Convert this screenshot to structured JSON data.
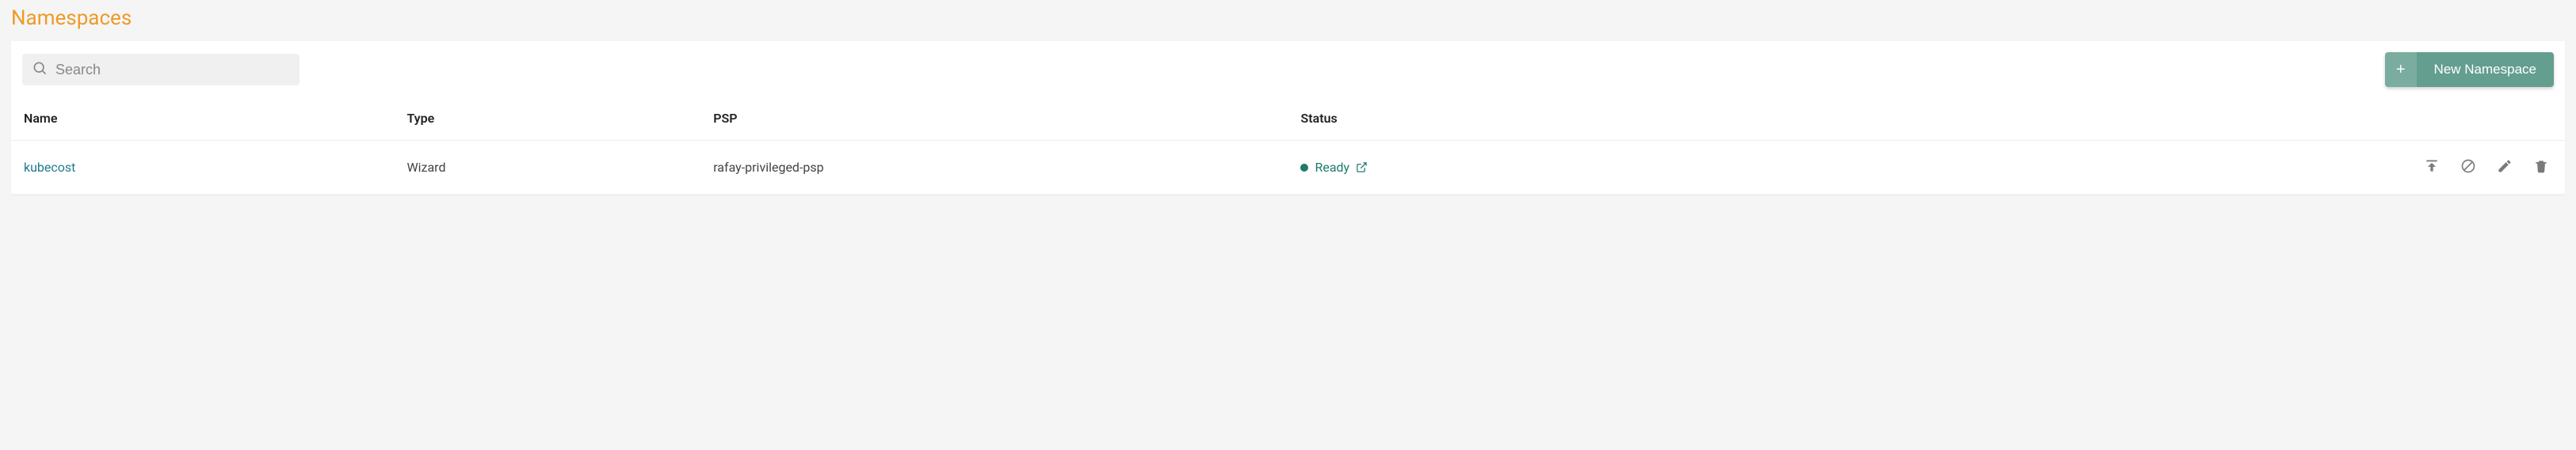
{
  "title": "Namespaces",
  "search": {
    "placeholder": "Search"
  },
  "new_button": {
    "label": "New Namespace"
  },
  "columns": {
    "name": "Name",
    "type": "Type",
    "psp": "PSP",
    "status": "Status"
  },
  "rows": [
    {
      "name": "kubecost",
      "type": "Wizard",
      "psp": "rafay-privileged-psp",
      "status": "Ready"
    }
  ],
  "colors": {
    "accent": "#ed9b28",
    "primary_button": "#639e8f",
    "status_ready": "#1f7a6b",
    "link": "#1f7a8c"
  }
}
